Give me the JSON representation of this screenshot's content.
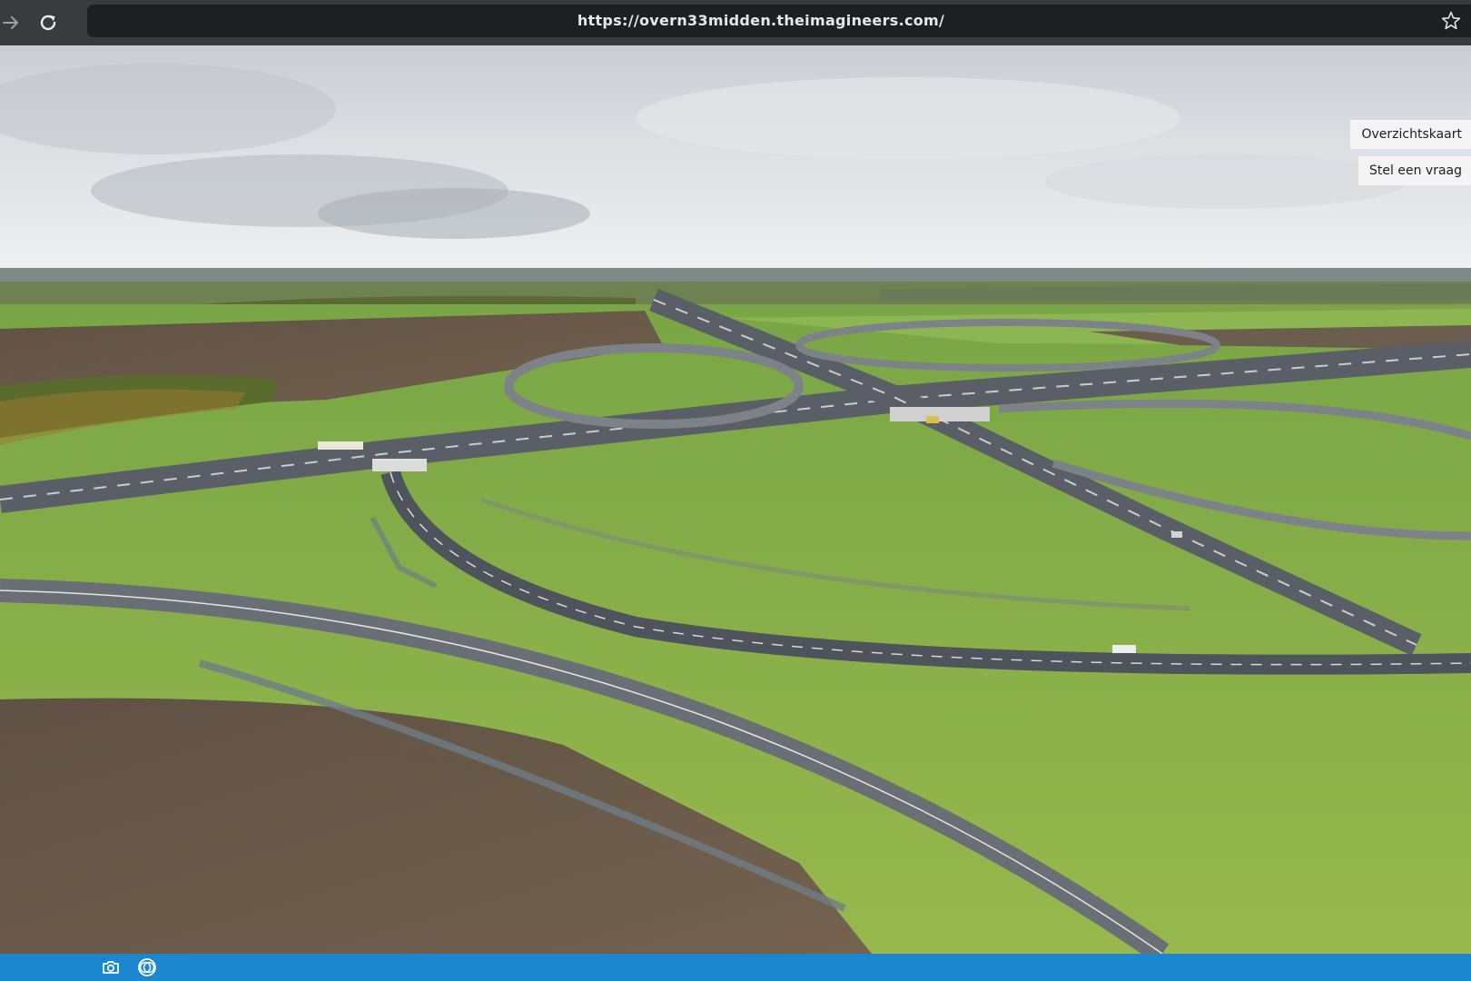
{
  "browser": {
    "url": "https://overn33midden.theimagineers.com/",
    "icons": {
      "forward": "arrow-right-icon",
      "reload": "reload-icon",
      "bookmark": "star-icon"
    }
  },
  "panorama": {
    "scene": "aerial view of motorway interchange with green fields",
    "buttons": {
      "overview_map": "Overzichtskaart",
      "ask_question": "Stel een vraag"
    }
  },
  "toolbar": {
    "color": "#1a87cf",
    "icons": {
      "snapshot": "camera-icon",
      "compare": "compare-circles-icon"
    }
  }
}
